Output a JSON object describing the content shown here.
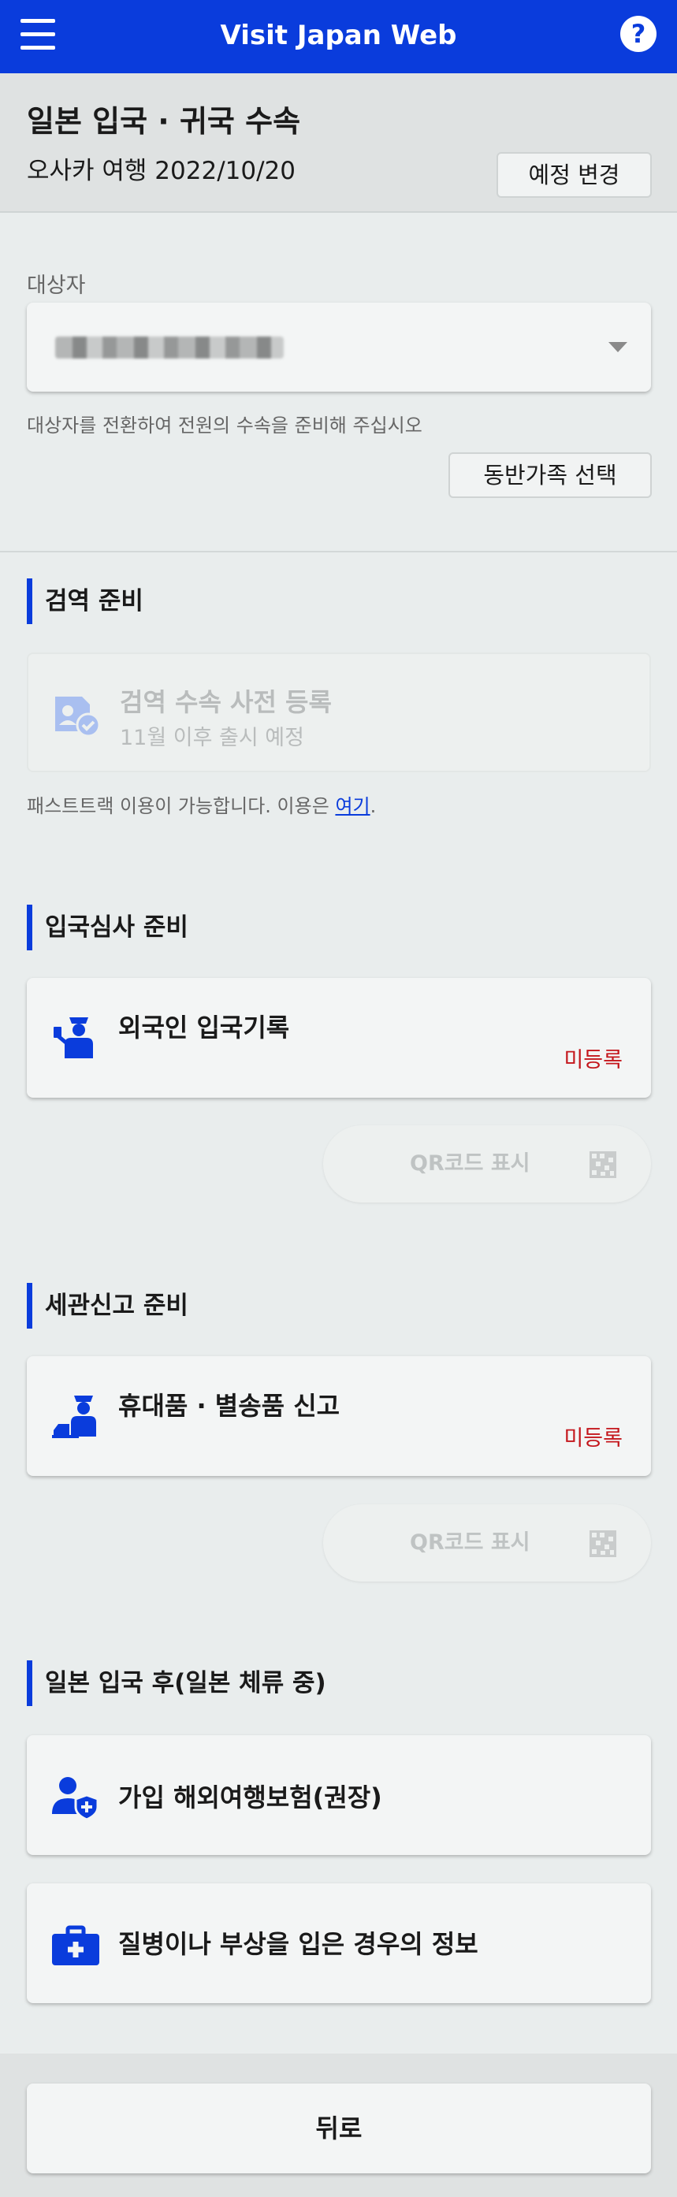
{
  "app": {
    "title": "Visit Japan Web",
    "help_symbol": "?"
  },
  "trip": {
    "title": "일본 입국 · 귀국 수속",
    "subtitle": "오사카 여행 2022/10/20",
    "change_button": "예정 변경"
  },
  "subject": {
    "label": "대상자",
    "hint": "대상자를 전환하여 전원의 수속을 준비해 주십시오",
    "family_button": "동반가족 선택"
  },
  "sections": {
    "quarantine": {
      "heading": "검역 준비",
      "card_title": "검역 수속 사전 등록",
      "card_sub": "11월 이후 출시 예정",
      "note_prefix": "패스트트랙 이용이 가능합니다. 이용은 ",
      "note_link": "여기",
      "note_suffix": "."
    },
    "immigration": {
      "heading": "입국심사 준비",
      "card_title": "외국인 입국기록",
      "status": "미등록",
      "qr_label": "QR코드 표시"
    },
    "customs": {
      "heading": "세관신고 준비",
      "card_title": "휴대품 · 별송품 신고",
      "status": "미등록",
      "qr_label": "QR코드 표시"
    },
    "after_entry": {
      "heading": "일본 입국 후(일본 체류 중)",
      "insurance_title": "가입 해외여행보험(권장)",
      "medical_title": "질병이나 부상을 입은 경우의 정보"
    }
  },
  "footer": {
    "back_label": "뒤로"
  },
  "colors": {
    "brand": "#0a3cdc",
    "status_unregistered": "#c4161c",
    "background": "#e9eded"
  },
  "icons": {
    "menu": "hamburger-icon",
    "help": "help-icon",
    "quarantine": "quarantine-registration-icon",
    "immigration": "immigration-officer-icon",
    "customs": "customs-officer-icon",
    "qr": "qr-code-icon",
    "insurance": "insurance-shield-icon",
    "medical": "medical-kit-icon"
  }
}
